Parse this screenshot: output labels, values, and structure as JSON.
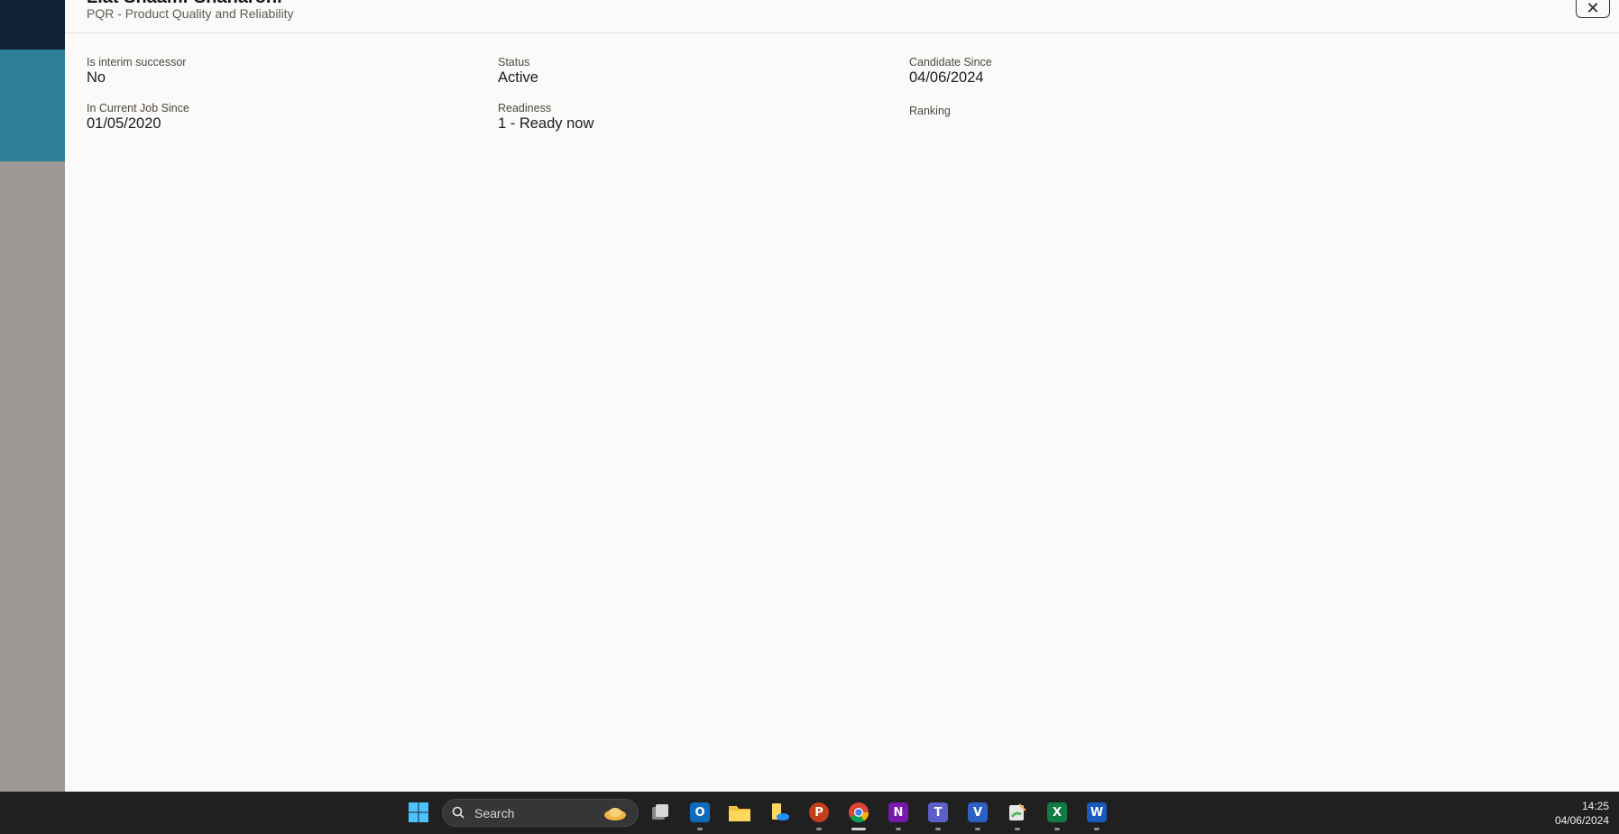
{
  "drawer": {
    "title": "Liat Shaami-Shaharoni",
    "subtitle": "PQR - Product Quality and Reliability",
    "close_icon": "close-icon"
  },
  "fields": [
    {
      "label": "Is interim successor",
      "value": "No"
    },
    {
      "label": "Status",
      "value": "Active"
    },
    {
      "label": "Candidate Since",
      "value": "04/06/2024"
    },
    {
      "label": "In Current Job Since",
      "value": "01/05/2020"
    },
    {
      "label": "Readiness",
      "value": "1 - Ready now"
    },
    {
      "label": "Ranking",
      "value": ""
    }
  ],
  "taskbar": {
    "search_placeholder": "Search",
    "apps": [
      "windows-start-icon",
      "task-view-icon",
      "outlook-icon",
      "file-explorer-icon",
      "onedrive-files-icon",
      "powerpoint-icon",
      "chrome-icon",
      "onenote-icon",
      "teams-icon",
      "visio-icon",
      "paint-icon",
      "excel-icon",
      "word-icon"
    ],
    "time": "14:25",
    "date": "04/06/2024"
  },
  "colors": {
    "drawer_bg": "#fbfaf8",
    "taskbar_bg": "#202021",
    "teal": "#2e7e98",
    "navy": "#0f2234"
  }
}
